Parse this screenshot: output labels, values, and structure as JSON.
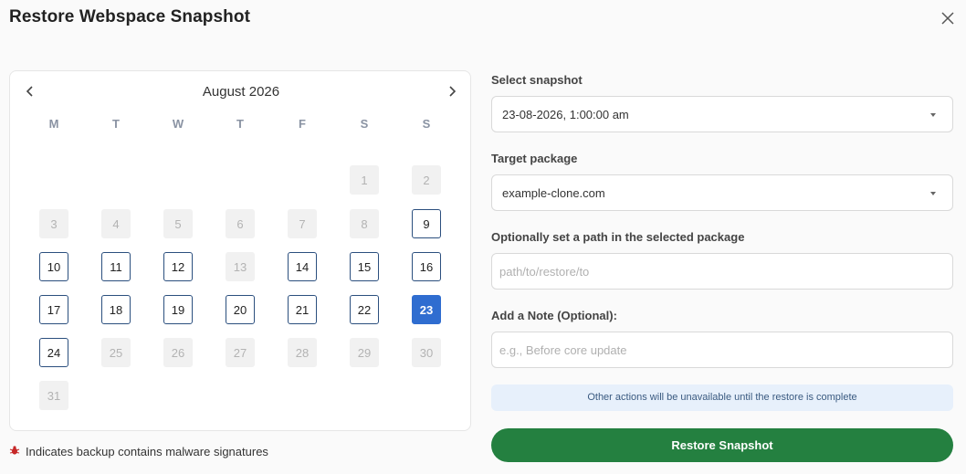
{
  "dialog": {
    "title": "Restore Webspace Snapshot"
  },
  "calendar": {
    "month_label": "August 2026",
    "weekdays": [
      "M",
      "T",
      "W",
      "T",
      "F",
      "S",
      "S"
    ],
    "days": [
      {
        "label": "1",
        "state": "disabled"
      },
      {
        "label": "2",
        "state": "disabled"
      },
      {
        "label": "3",
        "state": "disabled"
      },
      {
        "label": "4",
        "state": "disabled"
      },
      {
        "label": "5",
        "state": "disabled"
      },
      {
        "label": "6",
        "state": "disabled"
      },
      {
        "label": "7",
        "state": "disabled"
      },
      {
        "label": "8",
        "state": "disabled"
      },
      {
        "label": "9",
        "state": "available"
      },
      {
        "label": "10",
        "state": "available"
      },
      {
        "label": "11",
        "state": "available"
      },
      {
        "label": "12",
        "state": "available"
      },
      {
        "label": "13",
        "state": "disabled"
      },
      {
        "label": "14",
        "state": "available"
      },
      {
        "label": "15",
        "state": "available"
      },
      {
        "label": "16",
        "state": "available"
      },
      {
        "label": "17",
        "state": "available"
      },
      {
        "label": "18",
        "state": "available"
      },
      {
        "label": "19",
        "state": "available"
      },
      {
        "label": "20",
        "state": "available"
      },
      {
        "label": "21",
        "state": "available"
      },
      {
        "label": "22",
        "state": "available"
      },
      {
        "label": "23",
        "state": "selected"
      },
      {
        "label": "24",
        "state": "available"
      },
      {
        "label": "25",
        "state": "disabled"
      },
      {
        "label": "26",
        "state": "disabled"
      },
      {
        "label": "27",
        "state": "disabled"
      },
      {
        "label": "28",
        "state": "disabled"
      },
      {
        "label": "29",
        "state": "disabled"
      },
      {
        "label": "30",
        "state": "disabled"
      },
      {
        "label": "31",
        "state": "disabled"
      }
    ]
  },
  "legend": {
    "icon": "bug-icon",
    "text": "Indicates backup contains malware signatures"
  },
  "form": {
    "snapshot": {
      "label": "Select snapshot",
      "value": "23-08-2026, 1:00:00 am"
    },
    "package": {
      "label": "Target package",
      "value": "example-clone.com"
    },
    "path": {
      "label": "Optionally set a path in the selected package",
      "value": "",
      "placeholder": "path/to/restore/to"
    },
    "note": {
      "label": "Add a Note (Optional):",
      "value": "",
      "placeholder": "e.g., Before core update"
    }
  },
  "info_text": "Other actions will be unavailable until the restore is complete",
  "restore_button_label": "Restore Snapshot",
  "colors": {
    "primary_button": "#248040",
    "selected_day": "#2f6dd0",
    "available_border": "#2b4f7e",
    "info_bg": "#e7f0fb"
  }
}
